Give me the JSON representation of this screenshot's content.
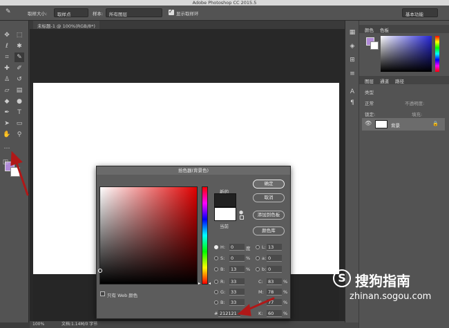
{
  "window": {
    "title": "Adobe Photoshop CC 2015.5"
  },
  "options_bar": {
    "sample_size_label": "取样大小:",
    "sample_size_value": "取样点",
    "sample_label": "样本:",
    "sample_value": "所有图层",
    "show_ring_label": "显示取样环",
    "workspace": "基本功能"
  },
  "document": {
    "tab_title": "未标题-1 @ 100%(RGB/8*)"
  },
  "status": {
    "zoom": "100%",
    "doc_info": "文档:1.14M/0 字节"
  },
  "panels": {
    "color_tabs": [
      "颜色",
      "色板"
    ],
    "layers_tabs": [
      "图层",
      "通道",
      "路径"
    ],
    "filter_kind": "类型",
    "blend_mode": "正常",
    "opacity_label": "不透明度:",
    "lock_label": "锁定:",
    "fill_label": "填充:",
    "layer_name": "背景"
  },
  "dialog": {
    "title": "拾色器(背景色)",
    "new_label": "新的",
    "current_label": "当前",
    "ok": "确定",
    "cancel": "取消",
    "add_swatch": "添加到色板",
    "color_library": "颜色库",
    "web_only": "只有 Web 颜色",
    "fields": {
      "H": "0",
      "H_unit": "度",
      "S": "0",
      "S_unit": "%",
      "B": "13",
      "B_unit": "%",
      "R": "33",
      "G": "33",
      "Bv": "33",
      "L": "13",
      "a": "0",
      "b": "0",
      "C": "83",
      "M": "78",
      "Y": "77",
      "K": "60",
      "pct": "%",
      "hex_label": "#",
      "hex": "212121"
    }
  },
  "watermark": {
    "brand": "搜狗指南",
    "url": "zhinan.sogou.com"
  },
  "colors": {
    "foreground": "#b089d8",
    "background": "#ffffff",
    "new_color": "#212121",
    "arrow": "#b01818"
  }
}
